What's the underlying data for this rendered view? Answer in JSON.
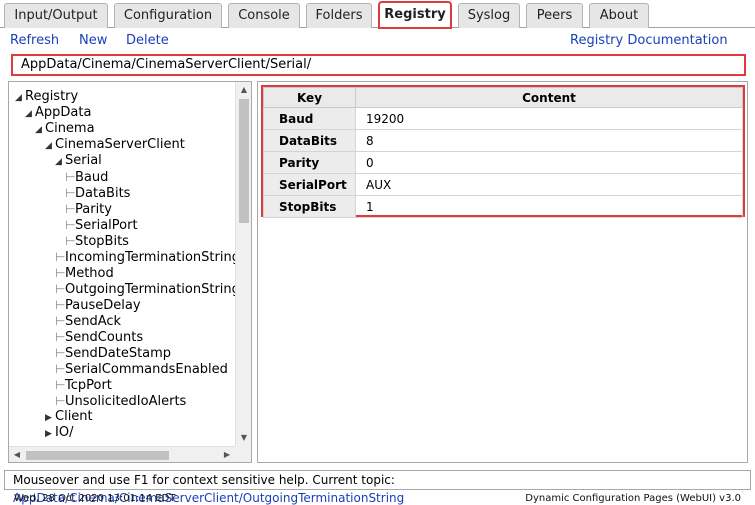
{
  "tabs": [
    "Input/Output",
    "Configuration",
    "Console",
    "Folders",
    "Registry",
    "Syslog",
    "Peers",
    "About"
  ],
  "actions": {
    "refresh": "Refresh",
    "new": "New",
    "delete": "Delete",
    "documentation": "Registry Documentation"
  },
  "path": "AppData/Cinema/CinemaServerClient/Serial/",
  "tree": {
    "root": "Registry",
    "appdata": "AppData",
    "cinema": "Cinema",
    "csc": "CinemaServerClient",
    "serial": "Serial",
    "serial_children": [
      "Baud",
      "DataBits",
      "Parity",
      "SerialPort",
      "StopBits"
    ],
    "csc_children": [
      "IncomingTerminationString",
      "Method",
      "OutgoingTerminationString",
      "PauseDelay",
      "SendAck",
      "SendCounts",
      "SendDateStamp",
      "SerialCommandsEnabled",
      "TcpPort",
      "UnsolicitedIoAlerts"
    ],
    "client": "Client",
    "io": "IO/"
  },
  "table": {
    "headers": [
      "Key",
      "Content"
    ],
    "rows": [
      {
        "key": "Baud",
        "value": "19200"
      },
      {
        "key": "DataBits",
        "value": "8"
      },
      {
        "key": "Parity",
        "value": "0"
      },
      {
        "key": "SerialPort",
        "value": "AUX"
      },
      {
        "key": "StopBits",
        "value": "1"
      }
    ]
  },
  "help": {
    "text": "Mouseover and use F1 for context sensitive help. Current topic: ",
    "topic": "AppData/Cinema/CinemaServerClient/OutgoingTerminationString"
  },
  "footer": {
    "datetime": "Wed, 28 Oct 2020 13:01:14 EDT",
    "version": "Dynamic Configuration Pages (WebUI) v3.0"
  }
}
